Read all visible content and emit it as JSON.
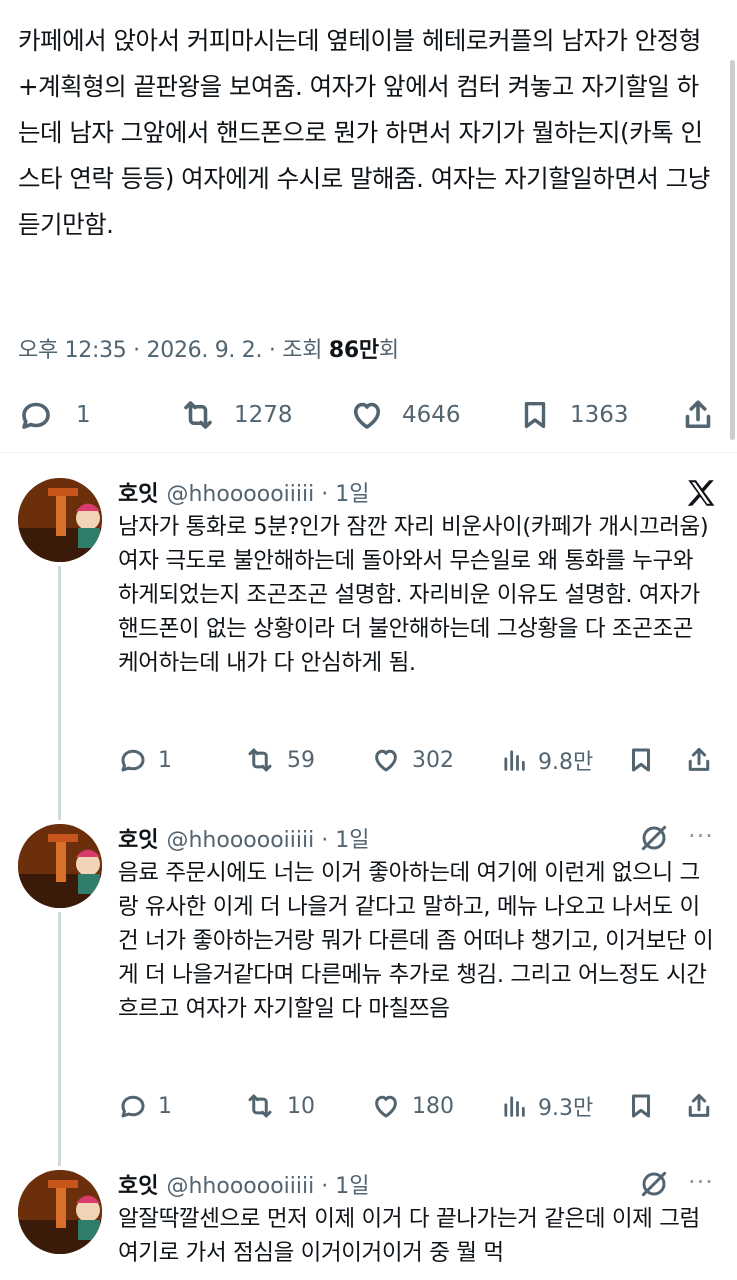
{
  "main": {
    "text": "카페에서 앉아서 커피마시는데 옆테이블 헤테로커플의 남자가 안정형+계획형의 끝판왕을 보여줌. 여자가 앞에서 컴터 켜놓고 자기할일 하는데 남자 그앞에서 핸드폰으로 뭔가 하면서 자기가 뭘하는지(카톡 인스타 연락 등등) 여자에게 수시로 말해줌. 여자는 자기할일하면서 그냥 듣기만함.",
    "meta_prefix": "오후 12:35 · 2026. 9. 2. · 조회 ",
    "views": "86만",
    "views_suffix": "회",
    "stats": {
      "replies": "1",
      "retweets": "1278",
      "likes": "4646",
      "bookmarks": "1363"
    }
  },
  "replies": [
    {
      "name": "호잇",
      "handle": "@hhoooooiiiii · 1일",
      "text": "남자가 통화로 5분?인가 잠깐 자리 비운사이(카페가 개시끄러움) 여자 극도로 불안해하는데 돌아와서 무슨일로 왜 통화를 누구와 하게되었는지 조곤조곤 설명함. 자리비운 이유도 설명함. 여자가 핸드폰이 없는 상황이라 더 불안해하는데 그상황을 다 조곤조곤 케어하는데 내가 다 안심하게 됨.",
      "stats": {
        "replies": "1",
        "retweets": "59",
        "likes": "302",
        "views": "9.8만"
      }
    },
    {
      "name": "호잇",
      "handle": "@hhoooooiiiii · 1일",
      "text": "음료 주문시에도 너는 이거 좋아하는데 여기에 이런게 없으니 그랑 유사한 이게 더 나을거 같다고 말하고, 메뉴 나오고 나서도 이건 너가 좋아하는거랑 뭐가 다른데 좀 어떠냐 챙기고, 이거보단 이게 더 나을거같다며 다른메뉴 추가로 챙김. 그리고 어느정도 시간 흐르고 여자가 자기할일 다 마칠쯔음",
      "stats": {
        "replies": "1",
        "retweets": "10",
        "likes": "180",
        "views": "9.3만"
      }
    },
    {
      "name": "호잇",
      "handle": "@hhoooooiiiii · 1일",
      "text": "알잘딱깔센으로 먼저 이제 이거 다 끝나가는거 같은데 이제 그럼 여기로 가서 점심을 이거이거이거 중 뭘 먹",
      "stats": {}
    }
  ],
  "more_label": "···",
  "colors": {
    "text": "#0f1419",
    "muted": "#536471",
    "divider": "#eff3f4",
    "thread": "#cfd9de"
  },
  "icons": [
    "reply-icon",
    "retweet-icon",
    "like-icon",
    "bookmark-icon",
    "share-icon",
    "views-icon",
    "x-logo-icon",
    "grok-icon",
    "more-icon"
  ]
}
